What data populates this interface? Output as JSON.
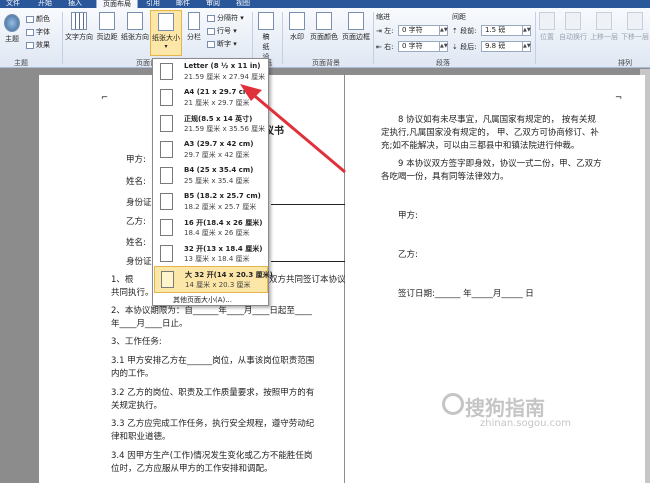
{
  "tabs": [
    "文件",
    "开始",
    "插入",
    "页面布局",
    "引用",
    "邮件",
    "审阅",
    "视图"
  ],
  "ribbon": {
    "theme_group": {
      "label": "主题",
      "main": "主题",
      "colors": "颜色",
      "fonts": "字体",
      "effects": "效果"
    },
    "page_setup_group": {
      "label": "页面设置",
      "text_direction": "文字方向",
      "margins": "页边距",
      "orientation": "纸张方向",
      "size": "纸张大小",
      "columns": "分栏",
      "breaks": "分隔符",
      "line_numbers": "行号",
      "hyphenation": "断字"
    },
    "manuscript_group": {
      "label": "稿纸",
      "paper_settings": "稿纸设置"
    },
    "page_background_group": {
      "label": "页面背景",
      "watermark": "水印",
      "page_color": "页面颜色",
      "page_borders": "页面边框"
    },
    "paragraph_group": {
      "label": "段落",
      "indent_title": "缩进",
      "spacing_title": "间距",
      "left_label": "左:",
      "right_label": "右:",
      "before_label": "段前:",
      "after_label": "段后:",
      "indent_left_value": "0 字符",
      "indent_right_value": "0 字符",
      "spacing_before_value": "1.5 磅",
      "spacing_after_value": "9.8 磅"
    },
    "arrange_group": {
      "label": "排列",
      "position": "位置",
      "wrap_text": "自动换行",
      "bring_forward": "上移一层",
      "send_backward": "下移一层"
    }
  },
  "paper_size_menu": {
    "items": [
      {
        "name": "Letter (8 ½ x 11 in)",
        "size": "21.59 厘米 x 27.94 厘米"
      },
      {
        "name": "A4 (21 x 29.7 cm)",
        "size": "21 厘米 x 29.7 厘米"
      },
      {
        "name": "正规(8.5 x 14 英寸)",
        "size": "21.59 厘米 x 35.56 厘米"
      },
      {
        "name": "A3 (29.7 x 42 cm)",
        "size": "29.7 厘米 x 42 厘米"
      },
      {
        "name": "B4 (25 x 35.4 cm)",
        "size": "25 厘米 x 35.4 厘米"
      },
      {
        "name": "B5 (18.2 x 25.7 cm)",
        "size": "18.2 厘米 x 25.7 厘米"
      },
      {
        "name": "16 开(18.4 x 26 厘米)",
        "size": "18.4 厘米 x 26 厘米"
      },
      {
        "name": "32 开(13 x 18.4 厘米)",
        "size": "13 厘米 x 18.4 厘米"
      },
      {
        "name": "大 32 开(14 x 20.3 厘米)",
        "size": "14 厘米 x 20.3 厘米"
      }
    ],
    "more": "其他页面大小(A)..."
  },
  "doc_left": {
    "title": "议书",
    "lines": [
      "甲方:",
      "姓名:",
      "身份证",
      "乙方:",
      "姓名:",
      "身份证",
      "1、根",
      "双方共同签订本协议,",
      "共同执行。",
      "2、本协议期限为：自______年____月____日起至____",
      "年____月____日止。",
      "3、工作任务:",
      "3.1 甲方安排乙方在______岗位，从事该岗位职责范围",
      "内的工作。",
      "3.2 乙方的岗位、职责及工作质量要求，按照甲方的有",
      "关规定执行。",
      "3.3 乙方应完成工作任务，执行安全规程，遵守劳动纪",
      "律和职业道德。",
      "3.4 因甲方生产(工作)情况发生变化或乙方不能胜任岗",
      "位时，乙方应服从甲方的工作安排和调配。"
    ]
  },
  "doc_right": {
    "lines": [
      "8 协议如有未尽事宜，凡属国家有规定的，  按有关规",
      "定执行,凡属国家没有规定的，  甲、乙双方可协商修订、补",
      "充;如不能解决，可以由三都县中和镇法院进行仲裁。",
      "9 本协议双方签字即身效，协议一式二份，甲、乙双方",
      "各吃喝一份，具有同等法律效力。",
      "甲方:",
      "乙方:",
      "签订日期:______ 年_____月_____ 日"
    ]
  },
  "watermark": {
    "cn": "搜狗指南",
    "en": "zhinan.sogou.com"
  },
  "colors": {
    "ribbon_blue": "#2a579a",
    "highlight": "#fde7a8",
    "arrow": "#e0303a"
  }
}
